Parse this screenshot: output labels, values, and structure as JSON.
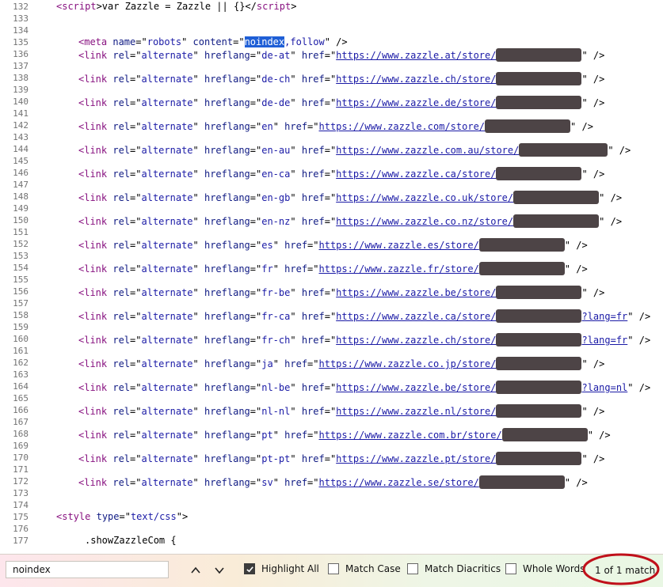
{
  "source_lines": [
    {
      "n": "132",
      "indent": 0,
      "parts": [
        [
          "tag",
          "<script"
        ],
        [
          "plain",
          ">var Zazzle = Zazzle || {}</"
        ],
        [
          "tag",
          "script"
        ],
        [
          "plain",
          ">"
        ]
      ]
    },
    {
      "n": "133",
      "indent": 0,
      "parts": []
    },
    {
      "n": "134",
      "indent": 0,
      "parts": []
    },
    {
      "n": "135",
      "indent": 1,
      "parts": [
        [
          "tag",
          "<meta"
        ],
        [
          "plain",
          " "
        ],
        [
          "attr",
          "name"
        ],
        [
          "plain",
          "=\""
        ],
        [
          "val",
          "robots"
        ],
        [
          "plain",
          "\" "
        ],
        [
          "attr",
          "content"
        ],
        [
          "plain",
          "=\""
        ],
        [
          "hl",
          "noindex"
        ],
        [
          "val",
          ",follow"
        ],
        [
          "plain",
          "\" />"
        ]
      ]
    },
    {
      "n": "136",
      "indent": 1,
      "kind": "link",
      "hreflang": "de-at",
      "url": "https://www.zazzle.at/store/",
      "redact_w": 108,
      "suffix": "",
      "tail": "\" />"
    },
    {
      "n": "137",
      "indent": 0,
      "parts": []
    },
    {
      "n": "138",
      "indent": 1,
      "kind": "link",
      "hreflang": "de-ch",
      "url": "https://www.zazzle.ch/store/",
      "redact_w": 108,
      "suffix": "",
      "tail": "\" />"
    },
    {
      "n": "139",
      "indent": 0,
      "parts": []
    },
    {
      "n": "140",
      "indent": 1,
      "kind": "link",
      "hreflang": "de-de",
      "url": "https://www.zazzle.de/store/",
      "redact_w": 108,
      "suffix": "",
      "tail": "\" />"
    },
    {
      "n": "141",
      "indent": 0,
      "parts": []
    },
    {
      "n": "142",
      "indent": 1,
      "kind": "link",
      "hreflang": "en",
      "url": "https://www.zazzle.com/store/",
      "redact_w": 108,
      "suffix": "",
      "tail": "\" />"
    },
    {
      "n": "143",
      "indent": 0,
      "parts": []
    },
    {
      "n": "144",
      "indent": 1,
      "kind": "link",
      "hreflang": "en-au",
      "url": "https://www.zazzle.com.au/store/",
      "redact_w": 112,
      "suffix": "",
      "tail": "\" />"
    },
    {
      "n": "145",
      "indent": 0,
      "parts": []
    },
    {
      "n": "146",
      "indent": 1,
      "kind": "link",
      "hreflang": "en-ca",
      "url": "https://www.zazzle.ca/store/",
      "redact_w": 108,
      "suffix": "",
      "tail": "\" />"
    },
    {
      "n": "147",
      "indent": 0,
      "parts": []
    },
    {
      "n": "148",
      "indent": 1,
      "kind": "link",
      "hreflang": "en-gb",
      "url": "https://www.zazzle.co.uk/store/",
      "redact_w": 108,
      "suffix": "",
      "tail": "\" />"
    },
    {
      "n": "149",
      "indent": 0,
      "parts": []
    },
    {
      "n": "150",
      "indent": 1,
      "kind": "link",
      "hreflang": "en-nz",
      "url": "https://www.zazzle.co.nz/store/",
      "redact_w": 108,
      "suffix": "",
      "tail": "\" />"
    },
    {
      "n": "151",
      "indent": 0,
      "parts": []
    },
    {
      "n": "152",
      "indent": 1,
      "kind": "link",
      "hreflang": "es",
      "url": "https://www.zazzle.es/store/",
      "redact_w": 108,
      "suffix": "",
      "tail": "\" />"
    },
    {
      "n": "153",
      "indent": 0,
      "parts": []
    },
    {
      "n": "154",
      "indent": 1,
      "kind": "link",
      "hreflang": "fr",
      "url": "https://www.zazzle.fr/store/",
      "redact_w": 108,
      "suffix": "",
      "tail": "\" />"
    },
    {
      "n": "155",
      "indent": 0,
      "parts": []
    },
    {
      "n": "156",
      "indent": 1,
      "kind": "link",
      "hreflang": "fr-be",
      "url": "https://www.zazzle.be/store/",
      "redact_w": 108,
      "suffix": "",
      "tail": "\" />"
    },
    {
      "n": "157",
      "indent": 0,
      "parts": []
    },
    {
      "n": "158",
      "indent": 1,
      "kind": "link",
      "hreflang": "fr-ca",
      "url": "https://www.zazzle.ca/store/",
      "redact_w": 108,
      "suffix": "?lang=fr",
      "tail": "\" />"
    },
    {
      "n": "159",
      "indent": 0,
      "parts": []
    },
    {
      "n": "160",
      "indent": 1,
      "kind": "link",
      "hreflang": "fr-ch",
      "url": "https://www.zazzle.ch/store/",
      "redact_w": 108,
      "suffix": "?lang=fr",
      "tail": "\" />"
    },
    {
      "n": "161",
      "indent": 0,
      "parts": []
    },
    {
      "n": "162",
      "indent": 1,
      "kind": "link",
      "hreflang": "ja",
      "url": "https://www.zazzle.co.jp/store/",
      "redact_w": 108,
      "suffix": "",
      "tail": "\" />"
    },
    {
      "n": "163",
      "indent": 0,
      "parts": []
    },
    {
      "n": "164",
      "indent": 1,
      "kind": "link",
      "hreflang": "nl-be",
      "url": "https://www.zazzle.be/store/",
      "redact_w": 108,
      "suffix": "?lang=nl",
      "tail": "\" />"
    },
    {
      "n": "165",
      "indent": 0,
      "parts": []
    },
    {
      "n": "166",
      "indent": 1,
      "kind": "link",
      "hreflang": "nl-nl",
      "url": "https://www.zazzle.nl/store/",
      "redact_w": 108,
      "suffix": "",
      "tail": "\" />"
    },
    {
      "n": "167",
      "indent": 0,
      "parts": []
    },
    {
      "n": "168",
      "indent": 1,
      "kind": "link",
      "hreflang": "pt",
      "url": "https://www.zazzle.com.br/store/",
      "redact_w": 108,
      "suffix": "",
      "tail": "\" />"
    },
    {
      "n": "169",
      "indent": 0,
      "parts": []
    },
    {
      "n": "170",
      "indent": 1,
      "kind": "link",
      "hreflang": "pt-pt",
      "url": "https://www.zazzle.pt/store/",
      "redact_w": 108,
      "suffix": "",
      "tail": "\" />"
    },
    {
      "n": "171",
      "indent": 0,
      "parts": []
    },
    {
      "n": "172",
      "indent": 1,
      "kind": "link",
      "hreflang": "sv",
      "url": "https://www.zazzle.se/store/",
      "redact_w": 108,
      "suffix": "",
      "tail": "\" />"
    },
    {
      "n": "173",
      "indent": 0,
      "parts": []
    },
    {
      "n": "174",
      "indent": 0,
      "parts": []
    },
    {
      "n": "175",
      "indent": 0,
      "parts": [
        [
          "tag",
          "<style"
        ],
        [
          "plain",
          " "
        ],
        [
          "attr",
          "type"
        ],
        [
          "plain",
          "=\""
        ],
        [
          "val",
          "text/css"
        ],
        [
          "plain",
          "\">"
        ]
      ]
    },
    {
      "n": "176",
      "indent": 0,
      "parts": []
    },
    {
      "n": "177",
      "indent": 2,
      "parts": [
        [
          "plain",
          ".showZazzleCom {"
        ]
      ]
    }
  ],
  "findbar": {
    "search_value": "noindex",
    "options": [
      {
        "label": "Highlight All",
        "checked": true
      },
      {
        "label": "Match Case",
        "checked": false
      },
      {
        "label": "Match Diacritics",
        "checked": false
      },
      {
        "label": "Whole Words",
        "checked": false
      }
    ],
    "match_count": "1 of 1 match"
  },
  "colors": {
    "tag": "#881280",
    "attr": "#0f1a83",
    "value": "#1a1aa6",
    "highlight": "#1f5fd6",
    "redaction": "#4d4446",
    "annotation_circle": "#c0101a"
  },
  "icons": [
    "chevron-up-icon",
    "chevron-down-icon",
    "checkmark-icon"
  ]
}
